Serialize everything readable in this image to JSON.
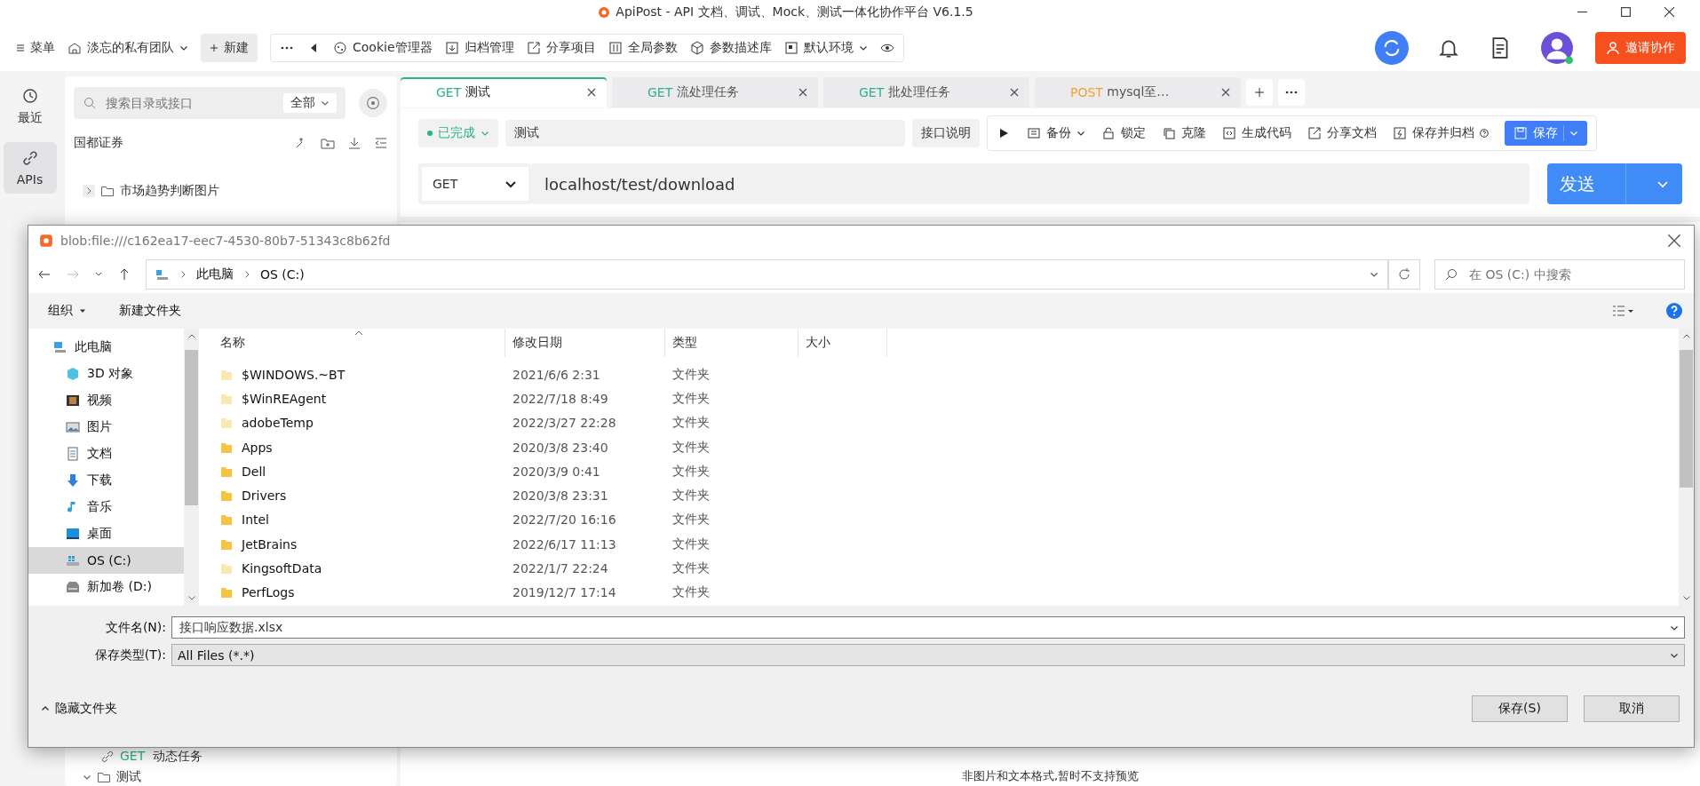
{
  "window": {
    "title": "ApiPost - API 文档、调试、Mock、测试一体化协作平台 V6.1.5"
  },
  "toolbar": {
    "menu": "菜单",
    "team": "淡忘的私有团队",
    "new_button": "新建",
    "items": [
      {
        "label": "Cookie管理器",
        "kind": "cookie"
      },
      {
        "label": "归档管理",
        "kind": "archive"
      },
      {
        "label": "分享项目",
        "kind": "share"
      },
      {
        "label": "全局参数",
        "kind": "params"
      },
      {
        "label": "参数描述库",
        "kind": "cube"
      },
      {
        "label": "默认环境",
        "kind": "env"
      }
    ],
    "invite": "邀请协作"
  },
  "nav": [
    {
      "label": "最近",
      "kind": "history",
      "selected": false
    },
    {
      "label": "APIs",
      "kind": "link",
      "selected": true
    }
  ],
  "sidebar": {
    "search_placeholder": "搜索目录或接口",
    "filter": "全部",
    "project": "国都证券",
    "tree": [
      {
        "label": "市场趋势判断图片"
      }
    ],
    "bottom_request": {
      "method": "GET",
      "label": "动态任务"
    },
    "bottom_folder": "测试"
  },
  "tabs": [
    {
      "method": "GET",
      "label": "测试",
      "selected": true
    },
    {
      "method": "GET",
      "label": "流处理任务",
      "selected": false
    },
    {
      "method": "GET",
      "label": "批处理任务",
      "selected": false
    },
    {
      "method": "POST",
      "label": "mysql至…",
      "selected": false
    }
  ],
  "request": {
    "status": "已完成",
    "name": "测试",
    "doc_button": "接口说明",
    "actions": [
      {
        "label": "备份",
        "kind": "backup"
      },
      {
        "label": "锁定",
        "kind": "lock"
      },
      {
        "label": "克隆",
        "kind": "clone"
      },
      {
        "label": "生成代码",
        "kind": "code"
      },
      {
        "label": "分享文档",
        "kind": "share"
      },
      {
        "label": "保存并归档",
        "kind": "archive"
      }
    ],
    "save": "保存",
    "method": "GET",
    "url": "localhost/test/download",
    "send": "发送"
  },
  "preview_note": "非图片和文本格式,暂时不支持预览",
  "dialog": {
    "title": "blob:file:///c162ea17-eec7-4530-80b7-51343c8b62fd",
    "path": [
      "此电脑",
      "OS (C:)"
    ],
    "search_placeholder": "在 OS (C:) 中搜索",
    "organize": "组织",
    "new_folder": "新建文件夹",
    "tree": [
      {
        "label": "此电脑",
        "kind": "pc",
        "selected": false,
        "children": [
          {
            "label": "3D 对象",
            "kind": "cube",
            "selected": false
          },
          {
            "label": "视频",
            "kind": "video",
            "selected": false
          },
          {
            "label": "图片",
            "kind": "image",
            "selected": false
          },
          {
            "label": "文档",
            "kind": "doc",
            "selected": false
          },
          {
            "label": "下载",
            "kind": "download",
            "selected": false
          },
          {
            "label": "音乐",
            "kind": "music",
            "selected": false
          },
          {
            "label": "桌面",
            "kind": "desktop",
            "selected": false
          },
          {
            "label": "OS (C:)",
            "kind": "drive",
            "selected": true
          },
          {
            "label": "新加卷 (D:)",
            "kind": "disk",
            "selected": false
          }
        ]
      }
    ],
    "columns": [
      "名称",
      "修改日期",
      "类型",
      "大小"
    ],
    "files": [
      {
        "name": "$WINDOWS.~BT",
        "date": "2021/6/6 2:31",
        "type": "文件夹",
        "hidden": true
      },
      {
        "name": "$WinREAgent",
        "date": "2022/7/18 8:49",
        "type": "文件夹",
        "hidden": true
      },
      {
        "name": "adobeTemp",
        "date": "2022/3/27 22:28",
        "type": "文件夹",
        "hidden": true
      },
      {
        "name": "Apps",
        "date": "2020/3/8 23:40",
        "type": "文件夹",
        "hidden": false
      },
      {
        "name": "Dell",
        "date": "2020/3/9 0:41",
        "type": "文件夹",
        "hidden": false
      },
      {
        "name": "Drivers",
        "date": "2020/3/8 23:31",
        "type": "文件夹",
        "hidden": false
      },
      {
        "name": "Intel",
        "date": "2022/7/20 16:16",
        "type": "文件夹",
        "hidden": false
      },
      {
        "name": "JetBrains",
        "date": "2022/6/17 11:13",
        "type": "文件夹",
        "hidden": false
      },
      {
        "name": "KingsoftData",
        "date": "2022/1/7 22:24",
        "type": "文件夹",
        "hidden": true
      },
      {
        "name": "PerfLogs",
        "date": "2019/12/7 17:14",
        "type": "文件夹",
        "hidden": false
      }
    ],
    "filename_label": "文件名(N):",
    "filename": "接口响应数据.xlsx",
    "filetype_label": "保存类型(T):",
    "filetype": "All Files (*.*)",
    "hide_folders": "隐藏文件夹",
    "save": "保存(S)",
    "cancel": "取消"
  }
}
